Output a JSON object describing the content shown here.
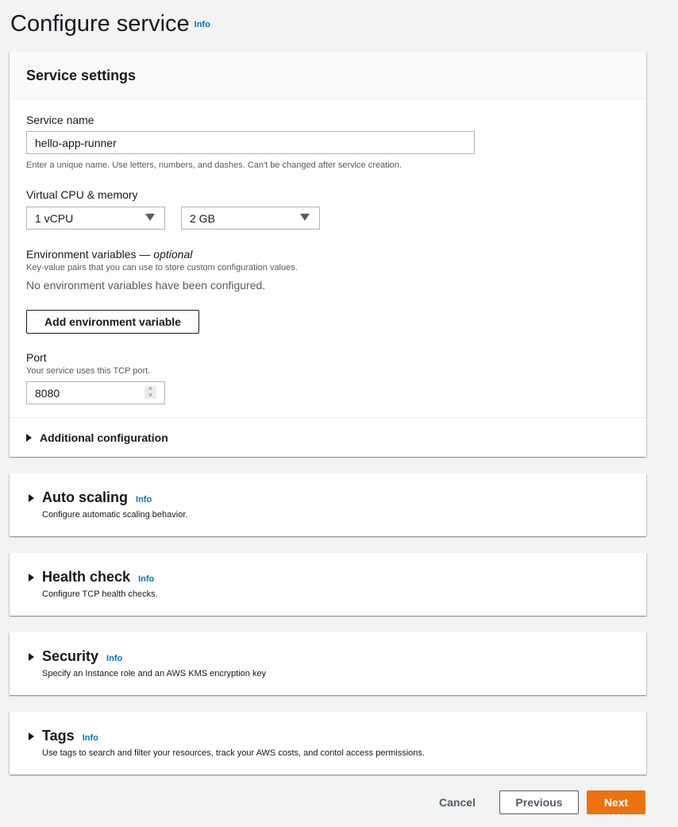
{
  "page": {
    "title": "Configure service",
    "info": "Info"
  },
  "service_settings": {
    "title": "Service settings",
    "service_name": {
      "label": "Service name",
      "value": "hello-app-runner",
      "hint": "Enter a unique name. Use letters, numbers, and dashes. Can't be changed after service creation."
    },
    "cpu_memory": {
      "label": "Virtual CPU & memory",
      "cpu": "1 vCPU",
      "memory": "2 GB"
    },
    "env": {
      "label": "Environment variables — ",
      "optional": "optional",
      "desc": "Key-value pairs that you can use to store custom configuration values.",
      "empty": "No environment variables have been configured.",
      "add_button": "Add environment variable"
    },
    "port": {
      "label": "Port",
      "desc": "Your service uses this TCP port.",
      "value": "8080"
    },
    "additional": "Additional configuration"
  },
  "sections": [
    {
      "title": "Auto scaling",
      "info": "Info",
      "desc": "Configure automatic scaling behavior."
    },
    {
      "title": "Health check",
      "info": "Info",
      "desc": "Configure TCP health checks."
    },
    {
      "title": "Security",
      "info": "Info",
      "desc": "Specify an Instance role and an AWS KMS encryption key"
    },
    {
      "title": "Tags",
      "info": "Info",
      "desc": "Use tags to search and filter your resources, track your AWS costs, and contol access permissions."
    }
  ],
  "footer": {
    "cancel": "Cancel",
    "previous": "Previous",
    "next": "Next"
  },
  "colors": {
    "primary": "#ec7211",
    "link": "#0073bb"
  }
}
